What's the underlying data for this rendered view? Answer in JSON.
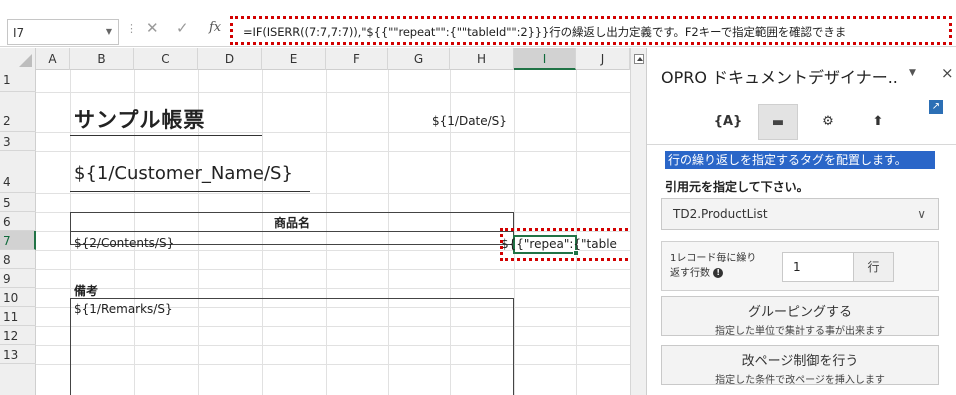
{
  "formula_bar": {
    "name_box": "I7",
    "fx_label": "fx",
    "formula": "=IF(ISERR((7:7,7:7)),\"${{\"\"repeat\"\":{\"\"tableId\"\":2}}}行の繰返し出力定義です。F2キーで指定範囲を確認できま"
  },
  "grid": {
    "columns": [
      "A",
      "B",
      "C",
      "D",
      "E",
      "F",
      "G",
      "H",
      "I",
      "J"
    ],
    "rows": [
      "1",
      "2",
      "3",
      "4",
      "5",
      "6",
      "7",
      "8",
      "9",
      "10",
      "11",
      "12",
      "13"
    ],
    "selected_column": "I",
    "selected_row": "7",
    "cells": {
      "title": "サンプル帳票",
      "date": "${1/Date/S}",
      "customer": "${1/Customer_Name/S}",
      "product_header": "商品名",
      "contents": "${2/Contents/S}",
      "repeat_tag": "${{\"repea\":{\"table",
      "remarks_label": "備考",
      "remarks": "${1/Remarks/S}"
    }
  },
  "panel": {
    "title": "OPRO ドキュメントデザイナー..",
    "menu_icon": "▼",
    "close_icon": "×",
    "toolbar": [
      {
        "name": "tag-icon",
        "glyph": "{A}"
      },
      {
        "name": "table-icon",
        "glyph": "▬"
      },
      {
        "name": "settings-icon",
        "glyph": "⚙"
      },
      {
        "name": "upload-icon",
        "glyph": "⬆"
      }
    ],
    "info_banner": "行の繰り返しを指定するタグを配置します。",
    "source_label": "引用元を指定して下さい。",
    "source_value": "TD2.ProductList",
    "rows_label": "1レコード毎に繰り返す行数",
    "rows_value": "1",
    "rows_unit": "行",
    "group_button": {
      "label": "グルーピングする",
      "desc": "指定した単位で集計する事が出来ます"
    },
    "pagebreak_button": {
      "label": "改ページ制御を行う",
      "desc": "指定した条件で改ページを挿入します"
    }
  },
  "colors": {
    "highlight": "#d20000",
    "accent": "#2a66c8",
    "excel_green": "#217346"
  }
}
